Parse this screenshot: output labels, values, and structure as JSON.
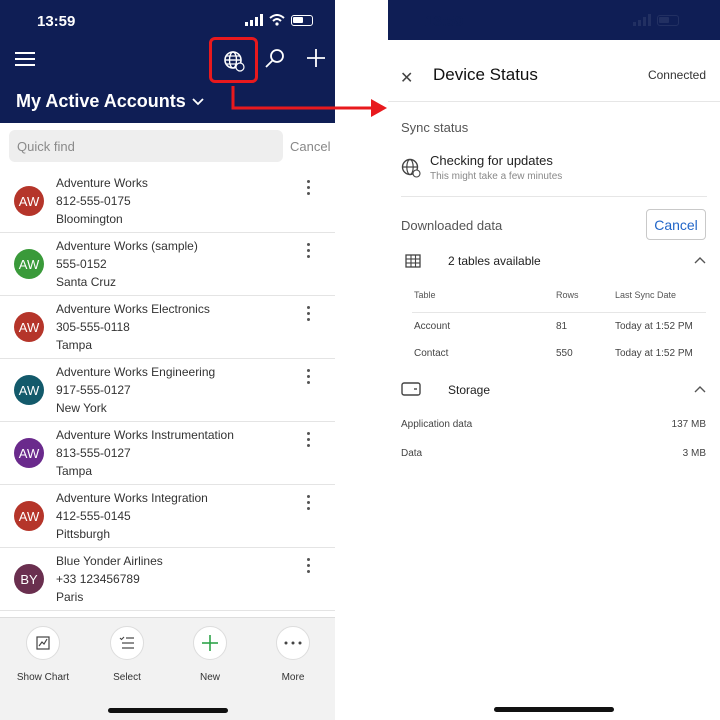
{
  "left": {
    "time": "13:59",
    "header": {
      "title": "My Active Accounts"
    },
    "search": {
      "placeholder": "Quick find",
      "cancel": "Cancel"
    },
    "accounts": [
      {
        "initials": "AW",
        "name": "Adventure Works",
        "phone": "812-555-0175",
        "city": "Bloomington",
        "color": "#b5352a"
      },
      {
        "initials": "AW",
        "name": "Adventure Works (sample)",
        "phone": "555-0152",
        "city": "Santa Cruz",
        "color": "#3a9a3a"
      },
      {
        "initials": "AW",
        "name": "Adventure Works Electronics",
        "phone": "305-555-0118",
        "city": "Tampa",
        "color": "#b5352a"
      },
      {
        "initials": "AW",
        "name": "Adventure Works Engineering",
        "phone": "917-555-0127",
        "city": "New York",
        "color": "#135a6b"
      },
      {
        "initials": "AW",
        "name": "Adventure Works Instrumentation",
        "phone": "813-555-0127",
        "city": "Tampa",
        "color": "#6a2a8c"
      },
      {
        "initials": "AW",
        "name": "Adventure Works Integration",
        "phone": "412-555-0145",
        "city": "Pittsburgh",
        "color": "#b5352a"
      },
      {
        "initials": "BY",
        "name": "Blue Yonder Airlines",
        "phone": "+33 123456789",
        "city": "Paris",
        "color": "#6a2f4f"
      }
    ],
    "bottom": [
      {
        "label": "Show Chart",
        "icon": "chart-icon"
      },
      {
        "label": "Select",
        "icon": "select-list-icon"
      },
      {
        "label": "New",
        "icon": "plus-icon"
      },
      {
        "label": "More",
        "icon": "more-icon"
      }
    ]
  },
  "right": {
    "title": "Device Status",
    "status": "Connected",
    "sync": {
      "heading": "Sync status",
      "title": "Checking for updates",
      "subtitle": "This might take a few minutes"
    },
    "downloaded": {
      "heading": "Downloaded data",
      "cancel": "Cancel",
      "tables_label": "2 tables available",
      "columns": [
        "Table",
        "Rows",
        "Last Sync Date"
      ],
      "rows": [
        {
          "table": "Account",
          "rows": "81",
          "date": "Today at 1:52 PM"
        },
        {
          "table": "Contact",
          "rows": "550",
          "date": "Today at 1:52 PM"
        }
      ]
    },
    "storage": {
      "label": "Storage",
      "items": [
        {
          "name": "Application data",
          "value": "137 MB"
        },
        {
          "name": "Data",
          "value": "3 MB"
        }
      ]
    }
  },
  "colors": {
    "header_bg": "#0f1e55",
    "highlight": "#e8191d",
    "link": "#2266c8",
    "new_accent": "#2fa34a"
  }
}
